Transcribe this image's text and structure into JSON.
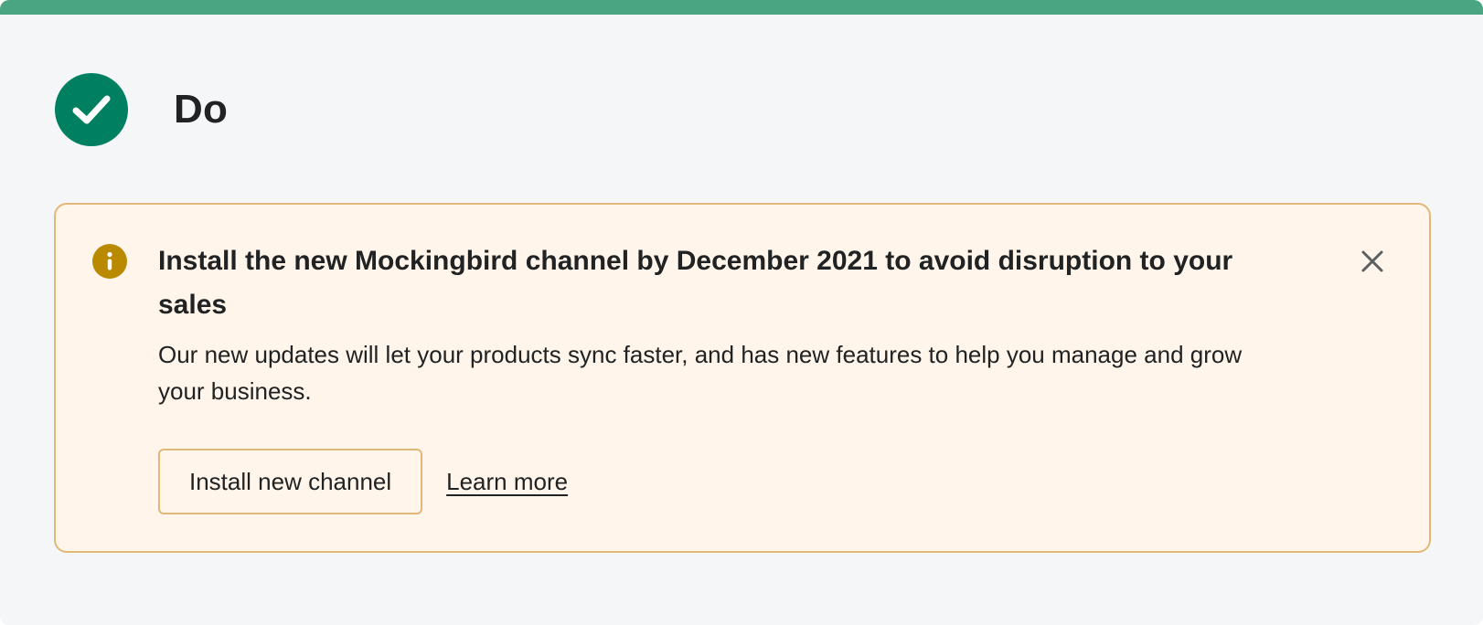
{
  "header": {
    "label": "Do",
    "icon": "check-circle-icon",
    "accent_color": "#4aa682",
    "icon_color": "#008060"
  },
  "banner": {
    "status_icon": "info-icon",
    "status_color": "#b98900",
    "title": "Install the new Mockingbird channel by December 2021 to avoid disruption to your sales",
    "body": "Our new updates will let your products sync faster, and has new features to help you manage and grow your business.",
    "primary_action_label": "Install new channel",
    "secondary_action_label": "Learn more",
    "dismiss_icon": "close-icon",
    "border_color": "#e1b878",
    "background_color": "#fff5ea"
  }
}
